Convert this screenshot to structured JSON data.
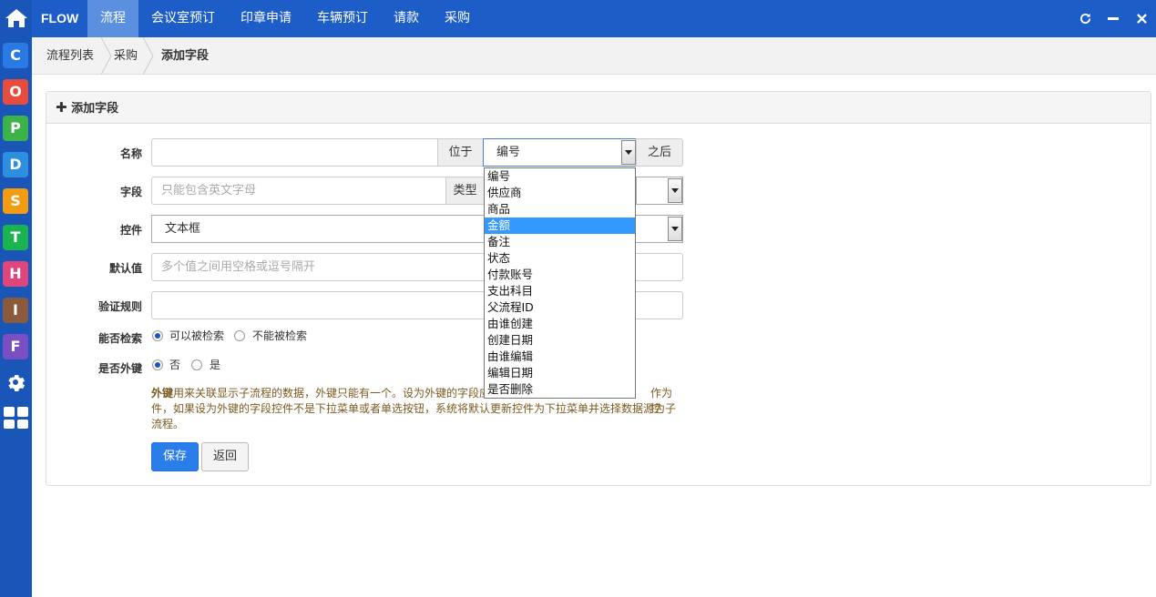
{
  "app": {
    "brand": "FLOW"
  },
  "nav": {
    "items": [
      "流程",
      "会议室预订",
      "印章申请",
      "车辆预订",
      "请款",
      "采购"
    ],
    "active_index": 0
  },
  "window_controls": {
    "refresh_icon": "refresh-icon",
    "minimize_icon": "minimize-icon",
    "close_icon": "close-icon"
  },
  "sidebar": {
    "home_icon": "home-icon",
    "apps": [
      {
        "letter": "C",
        "color": "#2a7ae4"
      },
      {
        "letter": "O",
        "color": "#e84c3d"
      },
      {
        "letter": "P",
        "color": "#3cb34a"
      },
      {
        "letter": "D",
        "color": "#2d8fe0"
      },
      {
        "letter": "S",
        "color": "#f39c12"
      },
      {
        "letter": "T",
        "color": "#1ab350"
      },
      {
        "letter": "H",
        "color": "#e0457b"
      },
      {
        "letter": "I",
        "color": "#8a5a3c"
      },
      {
        "letter": "F",
        "color": "#7b4fc4"
      }
    ],
    "settings_icon": "gear-icon",
    "grid_icon": "grid-icon"
  },
  "breadcrumb": {
    "items": [
      "流程列表",
      "采购",
      "添加字段"
    ]
  },
  "panel": {
    "title": "添加字段",
    "title_icon": "plus-icon"
  },
  "form": {
    "name": {
      "label": "名称",
      "value": "",
      "position_label": "位于",
      "position_value": "编号",
      "after_label": "之后"
    },
    "field": {
      "label": "字段",
      "placeholder": "只能包含英文字母",
      "type_label": "类型"
    },
    "control": {
      "label": "控件",
      "value": "文本框"
    },
    "default": {
      "label": "默认值",
      "placeholder": "多个值之间用空格或逗号隔开"
    },
    "validation": {
      "label": "验证规则",
      "value": ""
    },
    "searchable": {
      "label": "能否检索",
      "options": [
        "可以被检索",
        "不能被检索"
      ],
      "selected": 0
    },
    "foreign_key": {
      "label": "是否外键",
      "options": [
        "否",
        "是"
      ],
      "selected": 0
    }
  },
  "help": {
    "bold": "外键",
    "line1": "用来关联显示子流程的数据，外键只能有一个。设为外键的字段应",
    "line1_end": "作为控",
    "line2": "件，如果设为外键的字段控件不是下拉菜单或者单选按钮，系统将默认更新控件为下拉菜单并选择数据源为子",
    "line3": "流程。"
  },
  "buttons": {
    "save": "保存",
    "back": "返回"
  },
  "dropdown": {
    "options": [
      "编号",
      "供应商",
      "商品",
      "金额",
      "备注",
      "状态",
      "付款账号",
      "支出科目",
      "父流程ID",
      "由谁创建",
      "创建日期",
      "由谁编辑",
      "编辑日期",
      "是否删除"
    ],
    "highlighted_index": 3
  },
  "colors": {
    "sidebar": "#1a56b8",
    "topbar": "#1d5dc8",
    "nav_active": "#5b8fe0",
    "primary_button": "#2b7de9",
    "highlight": "#3399ff"
  }
}
